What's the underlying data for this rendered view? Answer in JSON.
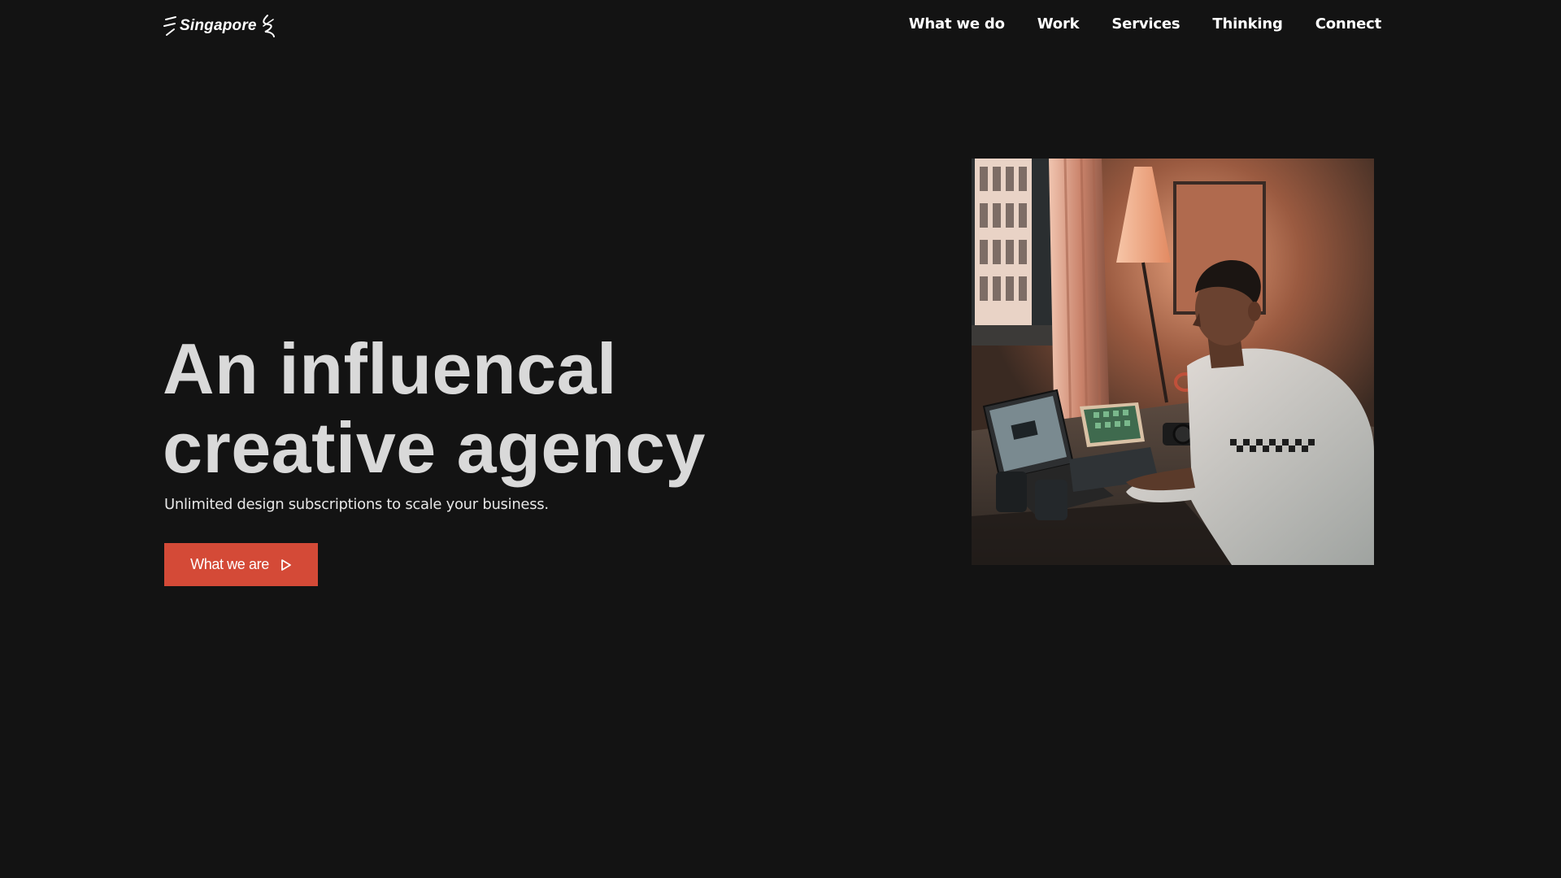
{
  "header": {
    "logo_text": "Singapore",
    "nav": [
      {
        "label": "What we do"
      },
      {
        "label": "Work"
      },
      {
        "label": "Services"
      },
      {
        "label": "Thinking"
      },
      {
        "label": "Connect"
      }
    ]
  },
  "hero": {
    "title_line1": "An influencal",
    "title_line2": "creative agency",
    "subtitle": "Unlimited design subscriptions to scale your business.",
    "cta_label": "What we are",
    "cta_icon": "play-outline-icon",
    "image_icon": "photo-person-working-at-desk"
  },
  "colors": {
    "background": "#131313",
    "accent": "#d44a37",
    "title": "#d9d9d9",
    "text": "#ffffff"
  }
}
